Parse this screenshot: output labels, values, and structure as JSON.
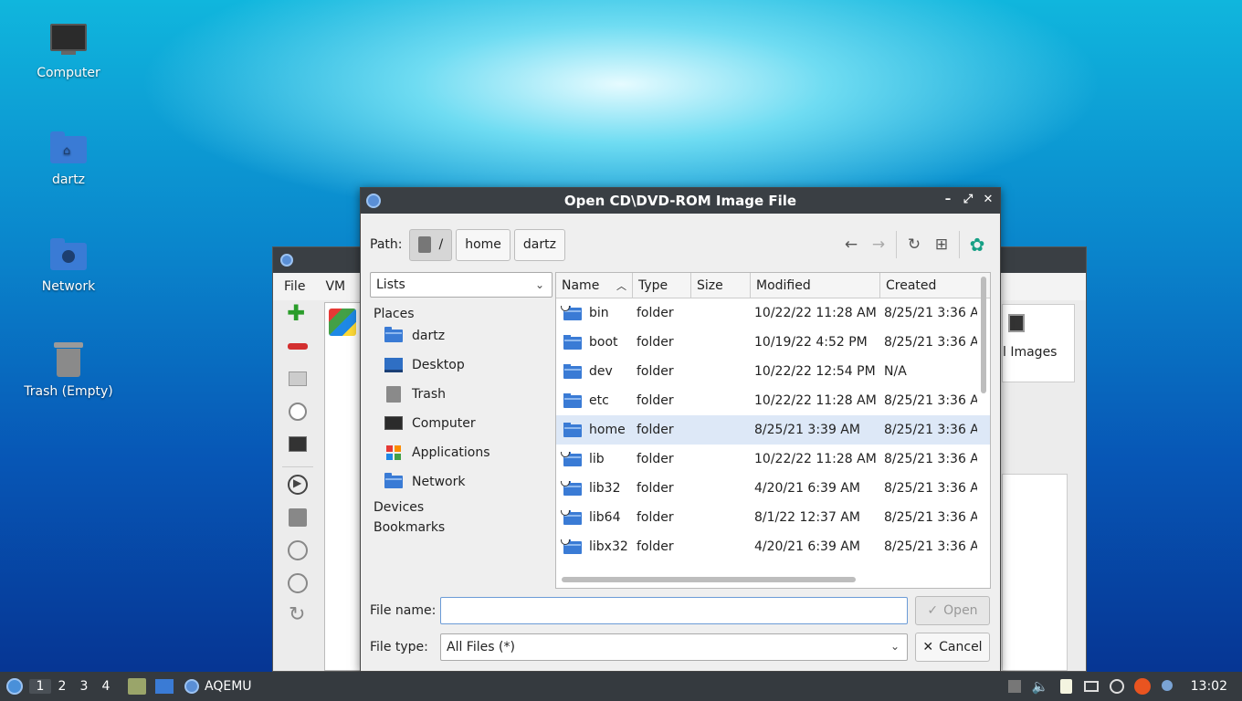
{
  "desktop": {
    "icons": [
      {
        "label": "Computer",
        "icon": "monitor-icon"
      },
      {
        "label": "dartz",
        "icon": "home-folder-icon"
      },
      {
        "label": "Network",
        "icon": "network-folder-icon"
      },
      {
        "label": "Trash (Empty)",
        "icon": "trash-icon"
      }
    ]
  },
  "back_window": {
    "menu": [
      "File",
      "VM"
    ],
    "right_label": "l Images"
  },
  "dialog": {
    "title": "Open CD\\DVD-ROM Image File",
    "path_label": "Path:",
    "path_segments": [
      "/",
      "home",
      "dartz"
    ],
    "places_combo": "Lists",
    "places_header": "Places",
    "places": [
      {
        "label": "dartz",
        "icon": "home-folder-icon"
      },
      {
        "label": "Desktop",
        "icon": "desktop-icon"
      },
      {
        "label": "Trash",
        "icon": "trash-icon"
      },
      {
        "label": "Computer",
        "icon": "monitor-icon"
      },
      {
        "label": "Applications",
        "icon": "applications-icon"
      },
      {
        "label": "Network",
        "icon": "network-folder-icon"
      }
    ],
    "devices_header": "Devices",
    "bookmarks_header": "Bookmarks",
    "columns": [
      "Name",
      "Type",
      "Size",
      "Modified",
      "Created"
    ],
    "files": [
      {
        "name": "bin",
        "type": "folder",
        "size": "",
        "modified": "10/22/22 11:28 AM",
        "created": "8/25/21 3:36 A",
        "link": true
      },
      {
        "name": "boot",
        "type": "folder",
        "size": "",
        "modified": "10/19/22 4:52 PM",
        "created": "8/25/21 3:36 A",
        "link": false
      },
      {
        "name": "dev",
        "type": "folder",
        "size": "",
        "modified": "10/22/22 12:54 PM",
        "created": "N/A",
        "link": false
      },
      {
        "name": "etc",
        "type": "folder",
        "size": "",
        "modified": "10/22/22 11:28 AM",
        "created": "8/25/21 3:36 A",
        "link": false
      },
      {
        "name": "home",
        "type": "folder",
        "size": "",
        "modified": "8/25/21 3:39 AM",
        "created": "8/25/21 3:36 A",
        "link": false,
        "selected": true
      },
      {
        "name": "lib",
        "type": "folder",
        "size": "",
        "modified": "10/22/22 11:28 AM",
        "created": "8/25/21 3:36 A",
        "link": true
      },
      {
        "name": "lib32",
        "type": "folder",
        "size": "",
        "modified": "4/20/21 6:39 AM",
        "created": "8/25/21 3:36 A",
        "link": true
      },
      {
        "name": "lib64",
        "type": "folder",
        "size": "",
        "modified": "8/1/22 12:37 AM",
        "created": "8/25/21 3:36 A",
        "link": true
      },
      {
        "name": "libx32",
        "type": "folder",
        "size": "",
        "modified": "4/20/21 6:39 AM",
        "created": "8/25/21 3:36 A",
        "link": true
      }
    ],
    "filename_label": "File name:",
    "filename_value": "",
    "open_label": "Open",
    "filetype_label": "File type:",
    "filetype_value": "All Files (*)",
    "cancel_label": "Cancel"
  },
  "taskbar": {
    "workspaces": [
      "1",
      "2",
      "3",
      "4"
    ],
    "active_workspace": "1",
    "task_label": "AQEMU",
    "clock": "13:02"
  }
}
